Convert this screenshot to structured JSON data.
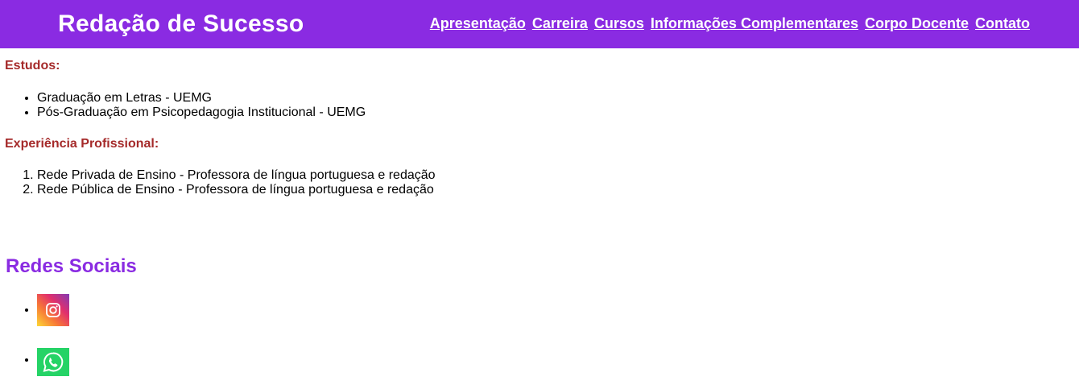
{
  "header": {
    "site_title": "Redação de Sucesso",
    "brand_color": "#8a2be2",
    "nav": [
      {
        "label": "Apresentação"
      },
      {
        "label": "Carreira"
      },
      {
        "label": "Cursos"
      },
      {
        "label": "Informações Complementares"
      },
      {
        "label": "Corpo Docente"
      },
      {
        "label": "Contato"
      }
    ]
  },
  "studies": {
    "label": "Estudos:",
    "items": [
      "Graduação em Letras - UEMG",
      "Pós-Graduação em Psicopedagogia Institucional - UEMG"
    ]
  },
  "experience": {
    "label": "Experiência Profissional:",
    "items": [
      "Rede Privada de Ensino - Professora de língua portuguesa e redação",
      "Rede Pública de Ensino - Professora de língua portuguesa e redação"
    ]
  },
  "social": {
    "heading": "Redes Sociais",
    "links": [
      {
        "icon": "instagram-icon"
      },
      {
        "icon": "whatsapp-icon"
      }
    ]
  },
  "colors": {
    "section_label": "#a52a2a",
    "social_heading": "#8a2be2",
    "whatsapp": "#25d366"
  }
}
